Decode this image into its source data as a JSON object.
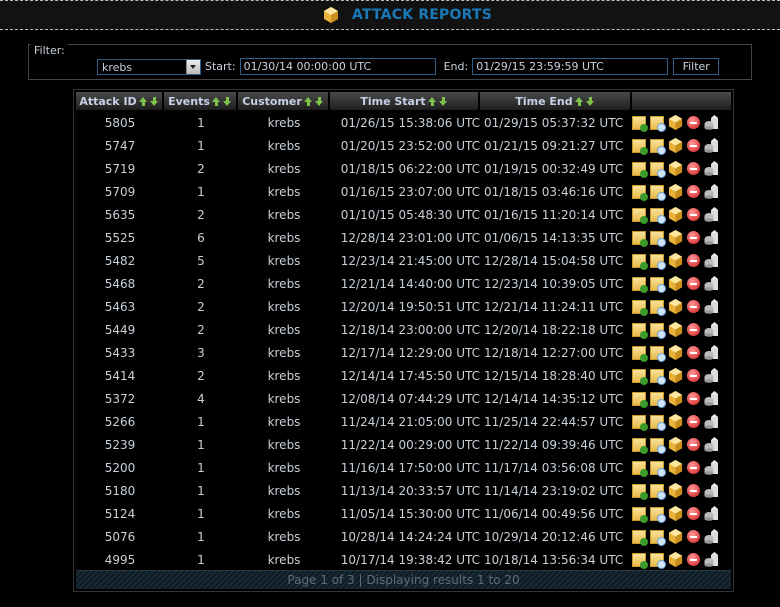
{
  "header": {
    "title": "ATTACK REPORTS",
    "icon": "cube-icon"
  },
  "filter": {
    "legend": "Filter:",
    "customer_selected": "krebs",
    "start_label": "Start:",
    "start_value": "01/30/14 00:00:00 UTC",
    "end_label": "End:",
    "end_value": "01/29/15 23:59:59 UTC",
    "button_label": "Filter"
  },
  "table": {
    "columns": [
      "Attack ID",
      "Events",
      "Customer",
      "Time Start",
      "Time End",
      ""
    ],
    "rows": [
      {
        "id": "5805",
        "events": "1",
        "customer": "krebs",
        "start": "01/26/15 15:38:06 UTC",
        "end": "01/29/15 05:37:32 UTC"
      },
      {
        "id": "5747",
        "events": "1",
        "customer": "krebs",
        "start": "01/20/15 23:52:00 UTC",
        "end": "01/21/15 09:21:27 UTC"
      },
      {
        "id": "5719",
        "events": "2",
        "customer": "krebs",
        "start": "01/18/15 06:22:00 UTC",
        "end": "01/19/15 00:32:49 UTC"
      },
      {
        "id": "5709",
        "events": "1",
        "customer": "krebs",
        "start": "01/16/15 23:07:00 UTC",
        "end": "01/18/15 03:46:16 UTC"
      },
      {
        "id": "5635",
        "events": "2",
        "customer": "krebs",
        "start": "01/10/15 05:48:30 UTC",
        "end": "01/16/15 11:20:14 UTC"
      },
      {
        "id": "5525",
        "events": "6",
        "customer": "krebs",
        "start": "12/28/14 23:01:00 UTC",
        "end": "01/06/15 14:13:35 UTC"
      },
      {
        "id": "5482",
        "events": "5",
        "customer": "krebs",
        "start": "12/23/14 21:45:00 UTC",
        "end": "12/28/14 15:04:58 UTC"
      },
      {
        "id": "5468",
        "events": "2",
        "customer": "krebs",
        "start": "12/21/14 14:40:00 UTC",
        "end": "12/23/14 10:39:05 UTC"
      },
      {
        "id": "5463",
        "events": "2",
        "customer": "krebs",
        "start": "12/20/14 19:50:51 UTC",
        "end": "12/21/14 11:24:11 UTC"
      },
      {
        "id": "5449",
        "events": "2",
        "customer": "krebs",
        "start": "12/18/14 23:00:00 UTC",
        "end": "12/20/14 18:22:18 UTC"
      },
      {
        "id": "5433",
        "events": "3",
        "customer": "krebs",
        "start": "12/17/14 12:29:00 UTC",
        "end": "12/18/14 12:27:00 UTC"
      },
      {
        "id": "5414",
        "events": "2",
        "customer": "krebs",
        "start": "12/14/14 17:45:50 UTC",
        "end": "12/15/14 18:28:40 UTC"
      },
      {
        "id": "5372",
        "events": "4",
        "customer": "krebs",
        "start": "12/08/14 07:44:29 UTC",
        "end": "12/14/14 14:35:12 UTC"
      },
      {
        "id": "5266",
        "events": "1",
        "customer": "krebs",
        "start": "11/24/14 21:05:00 UTC",
        "end": "11/25/14 22:44:57 UTC"
      },
      {
        "id": "5239",
        "events": "1",
        "customer": "krebs",
        "start": "11/22/14 00:29:00 UTC",
        "end": "11/22/14 09:39:46 UTC"
      },
      {
        "id": "5200",
        "events": "1",
        "customer": "krebs",
        "start": "11/16/14 17:50:00 UTC",
        "end": "11/17/14 03:56:08 UTC"
      },
      {
        "id": "5180",
        "events": "1",
        "customer": "krebs",
        "start": "11/13/14 20:33:57 UTC",
        "end": "11/14/14 23:19:02 UTC"
      },
      {
        "id": "5124",
        "events": "1",
        "customer": "krebs",
        "start": "11/05/14 15:30:00 UTC",
        "end": "11/06/14 00:49:56 UTC"
      },
      {
        "id": "5076",
        "events": "1",
        "customer": "krebs",
        "start": "10/28/14 14:24:24 UTC",
        "end": "10/29/14 20:12:46 UTC"
      },
      {
        "id": "4995",
        "events": "1",
        "customer": "krebs",
        "start": "10/17/14 19:38:42 UTC",
        "end": "10/18/14 13:56:34 UTC"
      }
    ],
    "row_actions": [
      "add-note-icon",
      "view-note-icon",
      "package-icon",
      "delete-icon",
      "database-icon"
    ],
    "footer": "Page 1 of 3 | Displaying results 1 to 20"
  },
  "colors": {
    "title": "#1a7ab8",
    "sort_arrow": "#7fc24a",
    "input_border": "#2e5d85"
  }
}
